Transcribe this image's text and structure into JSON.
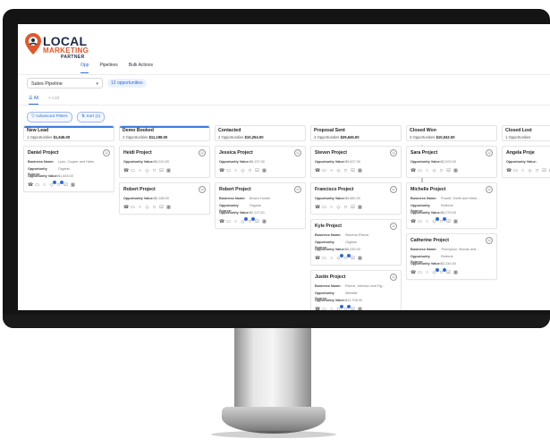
{
  "logo": {
    "word1": "LOCAL",
    "word2": "MARKETING",
    "word3": "PARTNER",
    "pin_color": "#e2572b",
    "dark_color": "#1f2a44"
  },
  "tabs": [
    {
      "label": "Opp",
      "active": true
    },
    {
      "label": "Pipelines",
      "active": false
    },
    {
      "label": "Bulk Actions",
      "active": false
    }
  ],
  "pipeline": {
    "selected": "Sales Pipeline",
    "count_badge": "12 opportunities"
  },
  "view_tabs": {
    "all": "All",
    "list": "+ List"
  },
  "toolbar": {
    "filters_label": "Advanced Filters",
    "sort_label": "Sort (1)"
  },
  "accent_color": "#2f6bd8",
  "columns": [
    {
      "name": "New Lead",
      "meta_count": "1 Opportunities",
      "meta_value": "$1,645.00",
      "cards": [
        {
          "title": "Daniel Project",
          "fields": [
            {
              "label": "Business Name:",
              "value": "Lyon, Cooper and Hahn"
            },
            {
              "label": "Opportunity Source:",
              "value": "Organic"
            },
            {
              "label": "Opportunity Value:",
              "value": "$1,645.00"
            }
          ]
        }
      ]
    },
    {
      "name": "Demo Booked",
      "meta_count": "2 Opportunities",
      "meta_value": "$11,198.00",
      "cards": [
        {
          "title": "Heidi Project",
          "fields": [
            {
              "label": "Opportunity Value:",
              "value": "$6,010.00"
            }
          ]
        },
        {
          "title": "Robert Project",
          "fields": [
            {
              "label": "Opportunity Value:",
              "value": "$5,188.00"
            }
          ]
        }
      ]
    },
    {
      "name": "Contacted",
      "meta_count": "2 Opportunities",
      "meta_value": "$10,254.00",
      "cards": [
        {
          "title": "Jessica Project",
          "fields": [
            {
              "label": "Opportunity Value:",
              "value": "$8,137.00"
            }
          ]
        },
        {
          "title": "Robert Project",
          "fields": [
            {
              "label": "Business Name:",
              "value": "Brown-Hunter"
            },
            {
              "label": "Opportunity Source:",
              "value": "Organic"
            },
            {
              "label": "Opportunity Value:",
              "value": "$2,117.00"
            }
          ]
        }
      ]
    },
    {
      "name": "Proposal Sent",
      "meta_count": "4 Opportunities",
      "meta_value": "$29,645.00",
      "cards": [
        {
          "title": "Steven Project",
          "fields": [
            {
              "label": "Opportunity Value:",
              "value": "$5,627.00"
            }
          ]
        },
        {
          "title": "Francisco Project",
          "fields": [
            {
              "label": "Opportunity Value:",
              "value": "$5,880.00"
            }
          ]
        },
        {
          "title": "Kyle Project",
          "fields": [
            {
              "label": "Business Name:",
              "value": "Stevens-Rivera"
            },
            {
              "label": "Opportunity Source:",
              "value": "Organic"
            },
            {
              "label": "Opportunity Value:",
              "value": "$6,030.00"
            }
          ]
        },
        {
          "title": "Justin Project",
          "fields": [
            {
              "label": "Business Name:",
              "value": "Rivera, Johnson and Fig..."
            },
            {
              "label": "Opportunity Source:",
              "value": "Website"
            },
            {
              "label": "Opportunity Value:",
              "value": "$12,708.00"
            }
          ]
        }
      ]
    },
    {
      "name": "Closed Won",
      "meta_count": "3 Opportunities",
      "meta_value": "$10,042.00",
      "cards": [
        {
          "title": "Sara Project",
          "fields": [
            {
              "label": "Opportunity Value:",
              "value": "$2,523.00"
            }
          ]
        },
        {
          "title": "Michelle Project",
          "fields": [
            {
              "label": "Business Name:",
              "value": "Powell, Smith and Mark..."
            },
            {
              "label": "Opportunity Source:",
              "value": "Referral"
            },
            {
              "label": "Opportunity Value:",
              "value": "$5,275.00"
            }
          ]
        },
        {
          "title": "Catherine Project",
          "fields": [
            {
              "label": "Business Name:",
              "value": "Thompson, Woods and ..."
            },
            {
              "label": "Opportunity Source:",
              "value": "Referral"
            },
            {
              "label": "Opportunity Value:",
              "value": "$2,244.00"
            }
          ]
        }
      ]
    },
    {
      "name": "Closed Lost",
      "meta_count": "1 Opportunities",
      "meta_value": "",
      "cards": [
        {
          "title": "Angela Proje",
          "fields": [
            {
              "label": "Opportunity Value:",
              "value": ""
            }
          ]
        }
      ]
    }
  ]
}
